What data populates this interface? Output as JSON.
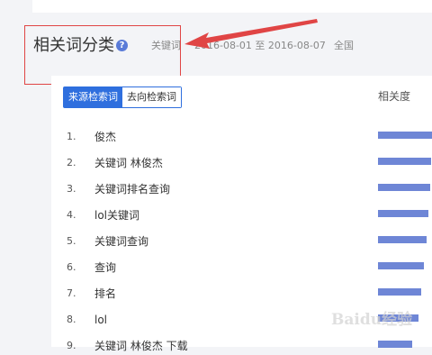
{
  "header": {
    "title": "相关词分类",
    "keyword_label": "关键词",
    "date_range": "2016-08-01 至 2016-08-07",
    "region": "全国"
  },
  "tabs": [
    {
      "label": "来源检索词",
      "active": true
    },
    {
      "label": "去向检索词",
      "active": false
    }
  ],
  "table": {
    "column_header": "相关度",
    "rows": [
      {
        "rank": "1.",
        "term": "俊杰",
        "relevance": 0.95
      },
      {
        "rank": "2.",
        "term": "关键词 林俊杰",
        "relevance": 0.92
      },
      {
        "rank": "3.",
        "term": "关键词排名查询",
        "relevance": 0.9
      },
      {
        "rank": "4.",
        "term": "lol关键词",
        "relevance": 0.88
      },
      {
        "rank": "5.",
        "term": "关键词查询",
        "relevance": 0.85
      },
      {
        "rank": "6.",
        "term": "查询",
        "relevance": 0.8
      },
      {
        "rank": "7.",
        "term": "排名",
        "relevance": 0.75
      },
      {
        "rank": "8.",
        "term": "lol",
        "relevance": 0.7
      },
      {
        "rank": "9.",
        "term": "关键词 林俊杰 下载",
        "relevance": 0.6
      }
    ]
  },
  "watermark": "Baidu经验",
  "colors": {
    "accent": "#2f6fde",
    "bar": "#6e86d6",
    "annotation": "#e04545"
  }
}
